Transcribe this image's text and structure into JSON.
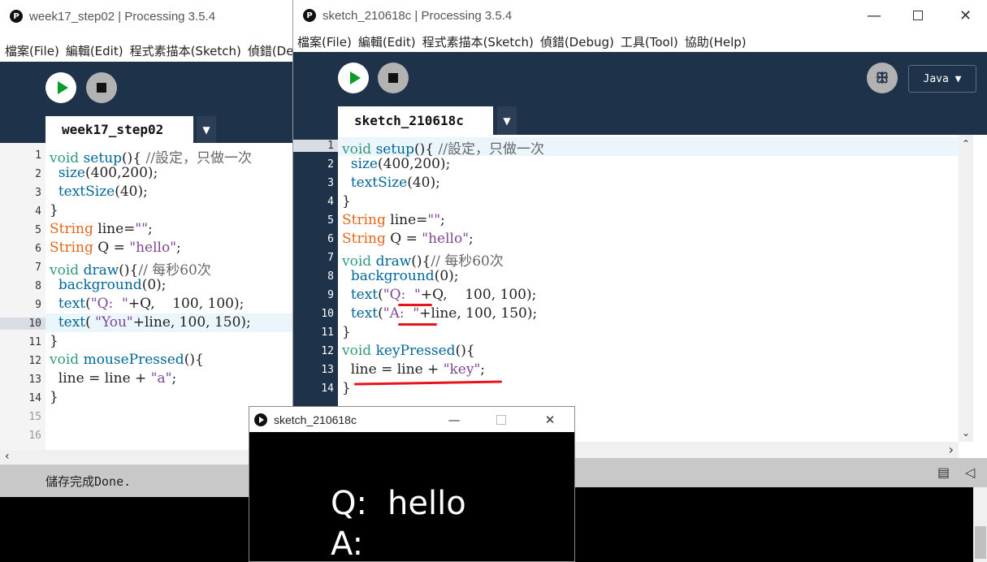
{
  "win1": {
    "title": "week17_step02 | Processing 3.5.4",
    "menu": [
      "檔案(File)",
      "編輯(Edit)",
      "程式素描本(Sketch)",
      "偵錯(Debu"
    ],
    "tab": "week17_step02",
    "line_numbers": [
      "1",
      "2",
      "3",
      "4",
      "5",
      "6",
      "7",
      "8",
      "9",
      "10",
      "11",
      "12",
      "13",
      "14",
      "15",
      "16"
    ],
    "status": "儲存完成Done."
  },
  "win2": {
    "title": "sketch_210618c | Processing 3.5.4",
    "menu": [
      "檔案(File)",
      "編輯(Edit)",
      "程式素描本(Sketch)",
      "偵錯(Debug)",
      "工具(Tool)",
      "協助(Help)"
    ],
    "tab": "sketch_210618c",
    "mode": "Java ▼",
    "line_numbers": [
      "1",
      "2",
      "3",
      "4",
      "5",
      "6",
      "7",
      "8",
      "9",
      "10",
      "11",
      "12",
      "13",
      "14"
    ]
  },
  "sketch_window": {
    "title": "sketch_210618c",
    "line1_label": "Q:",
    "line1_value": "hello",
    "line2_label": "A:"
  },
  "icons": {
    "play": "play-icon",
    "stop": "stop-icon",
    "debug": "butterfly-icon",
    "dropdown": "chevron-down-icon"
  },
  "colors": {
    "editor_bg": "#1e3249",
    "keyword": "#33997e",
    "function": "#006699",
    "type": "#e2661a",
    "string": "#7d4793",
    "underline": "#e8141c"
  }
}
